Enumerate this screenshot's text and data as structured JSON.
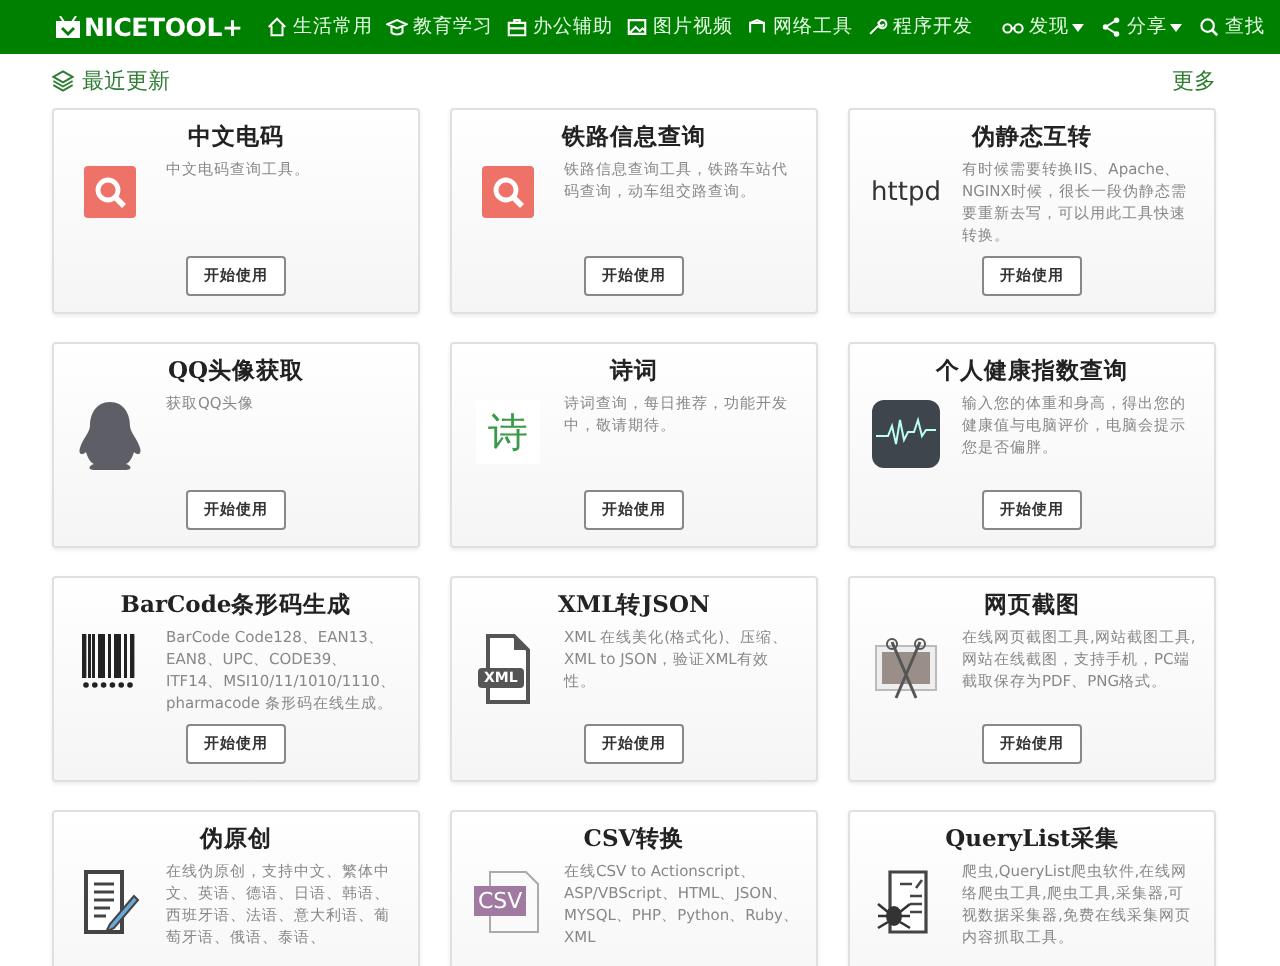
{
  "navbar": {
    "logo": "NICETOOL+",
    "items": [
      {
        "kind": "home",
        "label": "生活常用"
      },
      {
        "kind": "cap",
        "label": "教育学习"
      },
      {
        "kind": "case",
        "label": "办公辅助"
      },
      {
        "kind": "image",
        "label": "图片视频"
      },
      {
        "kind": "network",
        "label": "网络工具"
      },
      {
        "kind": "wrench",
        "label": "程序开发"
      }
    ],
    "right": [
      {
        "kind": "glasses",
        "label": "发现",
        "dropdown": true
      },
      {
        "kind": "share",
        "label": "分享",
        "dropdown": true
      },
      {
        "kind": "search",
        "label": "查找",
        "dropdown": false
      }
    ]
  },
  "section": {
    "title": "最近更新",
    "more": "更多"
  },
  "cards": [
    {
      "title": "中文电码",
      "description": "中文电码查询工具。",
      "kind": "search",
      "button": "开始使用"
    },
    {
      "title": "铁路信息查询",
      "description": "铁路信息查询工具，铁路车站代码查询，动车组交路查询。",
      "kind": "search",
      "button": "开始使用"
    },
    {
      "title": "伪静态互转",
      "description": "有时候需要转换IIS、Apache、NGINX时候，很长一段伪静态需要重新去写，可以用此工具快速转换。",
      "kind": "text-logo",
      "icon_text": "httpd",
      "button": "开始使用"
    },
    {
      "title": "QQ头像获取",
      "description": "获取QQ头像",
      "kind": "penguin",
      "button": "开始使用"
    },
    {
      "title": "诗词",
      "description": "诗词查询，每日推荐，功能开发中，敬请期待。",
      "kind": "glyph",
      "icon_text": "诗",
      "button": "开始使用"
    },
    {
      "title": "个人健康指数查询",
      "description": "输入您的体重和身高，得出您的健康值与电脑评价，电脑会提示您是否偏胖。",
      "kind": "heartbeat",
      "button": "开始使用"
    },
    {
      "title": "BarCode条形码生成",
      "description": "BarCode Code128、EAN13、EAN8、UPC、CODE39、ITF14、MSI10/11/1010/1110、pharmacode 条形码在线生成。",
      "kind": "barcode",
      "button": "开始使用"
    },
    {
      "title": "XML转JSON",
      "description": "XML 在线美化(格式化)、压缩、XML to JSON，验证XML有效性。",
      "kind": "file-label",
      "icon_text": "XML",
      "button": "开始使用"
    },
    {
      "title": "网页截图",
      "description": "在线网页截图工具,网站截图工具,网站在线截图，支持手机，PC端截取保存为PDF、PNG格式。",
      "kind": "screenshot",
      "button": "开始使用"
    },
    {
      "title": "伪原创",
      "description": "在线伪原创，支持中文、繁体中文、英语、德语、日语、韩语、西班牙语、法语、意大利语、葡萄牙语、俄语、泰语、",
      "kind": "document-pen"
    },
    {
      "title": "CSV转换",
      "description": "在线CSV to Actionscript、ASP/VBScript、HTML、JSON、MYSQL、PHP、Python、Ruby、XML",
      "kind": "csv",
      "icon_text": "CSV"
    },
    {
      "title": "QueryList采集",
      "description": "爬虫,QueryList爬虫软件,在线网络爬虫工具,爬虫工具,采集器,可视数据采集器,免费在线采集网页内容抓取工具。",
      "kind": "spider"
    }
  ]
}
